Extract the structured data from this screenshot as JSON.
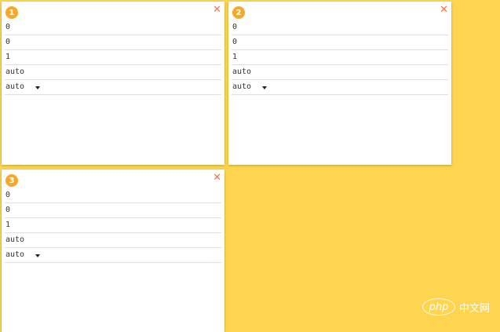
{
  "cards": [
    {
      "badge": "1",
      "close_icon": "close-icon",
      "fields": [
        "0",
        "0",
        "1",
        "auto"
      ],
      "select_value": "auto"
    },
    {
      "badge": "2",
      "close_icon": "close-icon",
      "fields": [
        "0",
        "0",
        "1",
        "auto"
      ],
      "select_value": "auto"
    },
    {
      "badge": "3",
      "close_icon": "close-icon",
      "fields": [
        "0",
        "0",
        "1",
        "auto"
      ],
      "select_value": "auto"
    }
  ],
  "close_glyph": "✕",
  "watermark": {
    "logo": "php",
    "text": "中文网"
  },
  "colors": {
    "background": "#ffd54f",
    "badge": "#f9a825",
    "close": "#ff7043",
    "card": "#ffffff"
  }
}
